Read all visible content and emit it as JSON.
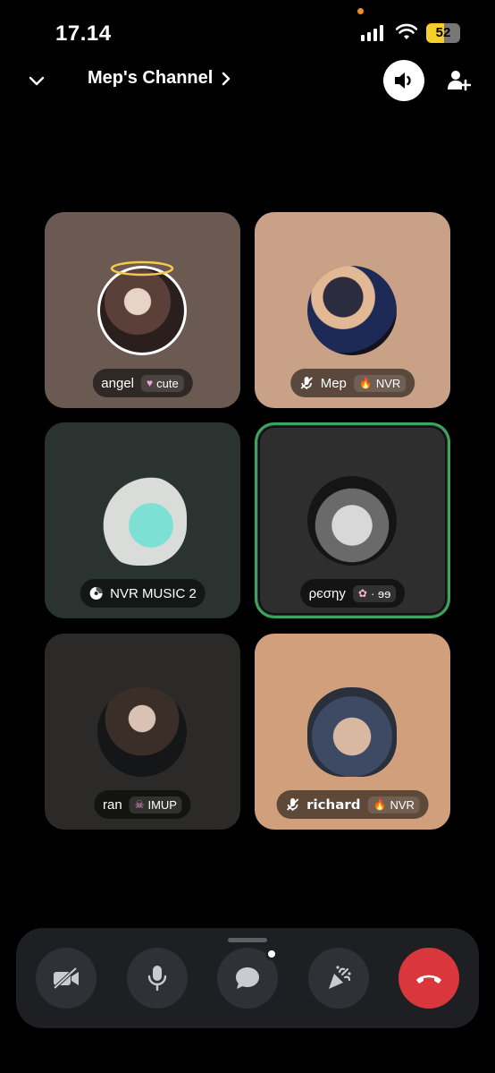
{
  "status_bar": {
    "time": "17.14",
    "battery": "52",
    "battery_level": 0.52,
    "icons": [
      "cellular-signal-icon",
      "wifi-icon",
      "battery-icon"
    ]
  },
  "header": {
    "title": "Mep's Channel",
    "icons": [
      "chevron-down-icon",
      "chevron-right-icon",
      "speaker-icon",
      "add-person-icon"
    ]
  },
  "participants": [
    {
      "name": "angel",
      "tag_icon": "heart-icon",
      "tag": "cute",
      "muted": false,
      "speaking": false,
      "bg": "#6b5a52"
    },
    {
      "name": "Mep",
      "tag_icon": "flame-icon",
      "tag": "NVR",
      "muted": true,
      "speaking": false,
      "bg": "#c9a186"
    },
    {
      "name": "NVR MUSIC 2",
      "tag_icon": "",
      "tag": "",
      "muted": false,
      "speaking": false,
      "bg": "#2a3330",
      "name_icon": "music-disc-icon"
    },
    {
      "name": "ρєσηу",
      "tag_icon": "flower-icon",
      "tag": "· ɘɘ",
      "muted": false,
      "speaking": true,
      "bg": "#2e2e2e"
    },
    {
      "name": "ran",
      "tag_icon": "skull-icon",
      "tag": "IMUP",
      "muted": false,
      "speaking": false,
      "bg": "#2b2a29"
    },
    {
      "name": "𝗿𝗶𝗰𝗵𝗮𝗿𝗱",
      "tag_icon": "flame-icon",
      "tag": "NVR",
      "muted": true,
      "speaking": false,
      "bg": "#d0a07c"
    }
  ],
  "controls": [
    {
      "name": "camera-off-button",
      "icon": "camera-off-icon"
    },
    {
      "name": "microphone-button",
      "icon": "microphone-icon"
    },
    {
      "name": "chat-button",
      "icon": "chat-bubble-icon"
    },
    {
      "name": "soundboard-button",
      "icon": "party-popper-icon"
    },
    {
      "name": "disconnect-button",
      "icon": "phone-hangup-icon"
    }
  ],
  "colors": {
    "background": "#000000",
    "speaking_ring": "#3ba55d",
    "end_call": "#da373c",
    "battery_fill": "#f5d02a",
    "control_bg": "#2f3136"
  }
}
